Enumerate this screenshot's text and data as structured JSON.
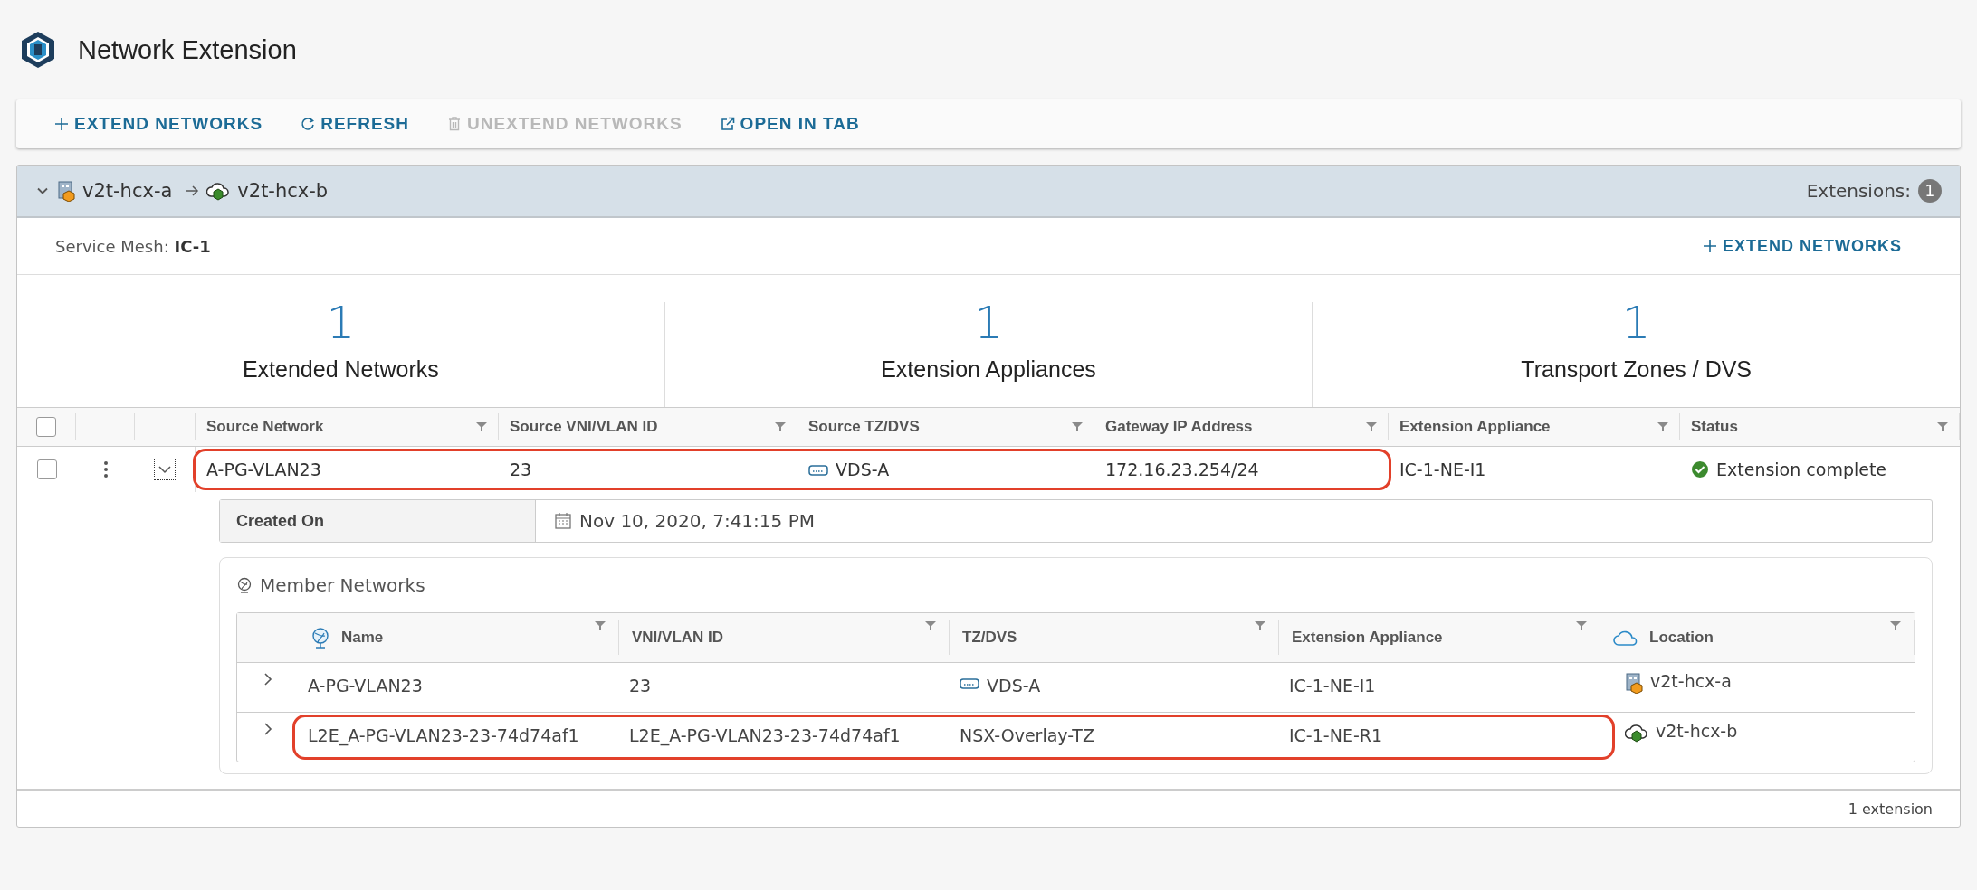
{
  "header": {
    "title": "Network Extension"
  },
  "toolbar": [
    {
      "label": "EXTEND NETWORKS",
      "disabled": false
    },
    {
      "label": "REFRESH",
      "disabled": false
    },
    {
      "label": "UNEXTEND NETWORKS",
      "disabled": true
    },
    {
      "label": "OPEN IN TAB",
      "disabled": false
    }
  ],
  "group": {
    "expanded": true,
    "source": "v2t-hcx-a",
    "destination": "v2t-hcx-b",
    "extensions_label": "Extensions:",
    "extensions_count": "1",
    "service_mesh_label": "Service Mesh:",
    "service_mesh": "IC-1",
    "extend_button": "EXTEND NETWORKS"
  },
  "stats": [
    {
      "value": "1",
      "label": "Extended Networks"
    },
    {
      "value": "1",
      "label": "Extension Appliances"
    },
    {
      "value": "1",
      "label": "Transport Zones / DVS"
    }
  ],
  "table": {
    "select_all": false,
    "columns": [
      "Source Network",
      "Source VNI/VLAN ID",
      "Source TZ/DVS",
      "Gateway IP Address",
      "Extension Appliance",
      "Status"
    ],
    "rows": [
      {
        "checked": false,
        "expanded": true,
        "highlighted": true,
        "source_network": "A-PG-VLAN23",
        "vni": "23",
        "tz": "VDS-A",
        "gateway": "172.16.23.254/24",
        "appliance": "IC-1-NE-I1",
        "status": "Extension complete",
        "detail": {
          "created_on_label": "Created On",
          "created_on": "Nov 10, 2020, 7:41:15 PM",
          "member_networks": {
            "title": "Member Networks",
            "columns": [
              "Name",
              "VNI/VLAN ID",
              "TZ/DVS",
              "Extension Appliance",
              "Location"
            ],
            "rows": [
              {
                "kind": "site",
                "expanded": false,
                "highlighted": false,
                "name": "A-PG-VLAN23",
                "vni": "23",
                "tz": "VDS-A",
                "appliance": "IC-1-NE-I1",
                "location": "v2t-hcx-a"
              },
              {
                "kind": "cloud",
                "expanded": false,
                "highlighted": true,
                "name": "L2E_A-PG-VLAN23-23-74d74af1",
                "vni": "L2E_A-PG-VLAN23-23-74d74af1",
                "tz": "NSX-Overlay-TZ",
                "appliance": "IC-1-NE-R1",
                "location": "v2t-hcx-b"
              }
            ]
          }
        }
      }
    ]
  },
  "footer": {
    "count": "1 extension"
  }
}
